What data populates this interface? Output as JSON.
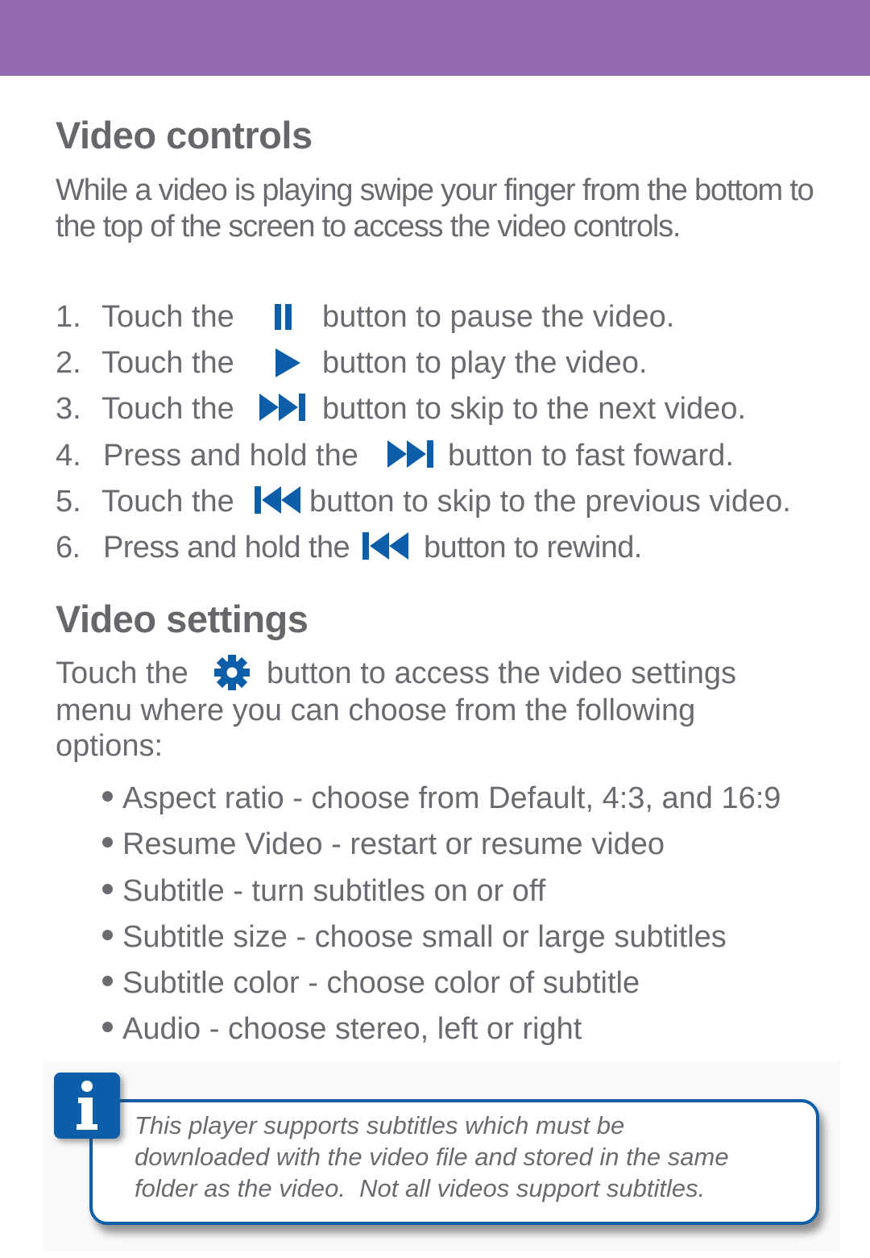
{
  "colors": {
    "header_band": "#936bac",
    "heading_text": "#66676b",
    "body_text": "#6a6b70",
    "icon_blue": "#0d5ea8"
  },
  "video_controls": {
    "title": "Video controls",
    "intro": "While a video is playing swipe your finger from the bottom to the top of the screen to access the video controls.",
    "steps": [
      {
        "number": "1.",
        "before": "Touch the",
        "icon": "pause-icon",
        "after": "button to pause the video."
      },
      {
        "number": "2.",
        "before": "Touch the",
        "icon": "play-icon",
        "after": "button to play the video."
      },
      {
        "number": "3.",
        "before": "Touch the",
        "icon": "skip-next-icon",
        "after": "button to skip to the next video."
      },
      {
        "number": "4.",
        "before": "Press and hold the",
        "icon": "skip-next-icon",
        "after": "button to fast foward."
      },
      {
        "number": "5.",
        "before": "Touch the",
        "icon": "skip-previous-icon",
        "after": "button to skip to the previous video."
      },
      {
        "number": "6.",
        "before": "Press and hold the",
        "icon": "skip-previous-icon",
        "after": "button to rewind."
      }
    ]
  },
  "video_settings": {
    "title": "Video settings",
    "intro_before": "Touch the",
    "intro_icon": "gear-icon",
    "intro_after_line1": "button to access the video settings",
    "intro_line2": "menu where you can choose from the following",
    "intro_line3": "options:",
    "options": [
      "Aspect ratio - choose from Default, 4:3, and 16:9",
      "Resume Video - restart or resume video",
      "Subtitle - turn subtitles on or off",
      "Subtitle size - choose small or large subtitles",
      "Subtitle color - choose color of subtitle",
      "Audio - choose stereo, left or right"
    ]
  },
  "note": {
    "icon": "info-icon",
    "lines": [
      "This player supports subtitles which must be",
      "downloaded with the video file and stored in the same",
      "folder as the video.  Not all videos support subtitles."
    ]
  }
}
